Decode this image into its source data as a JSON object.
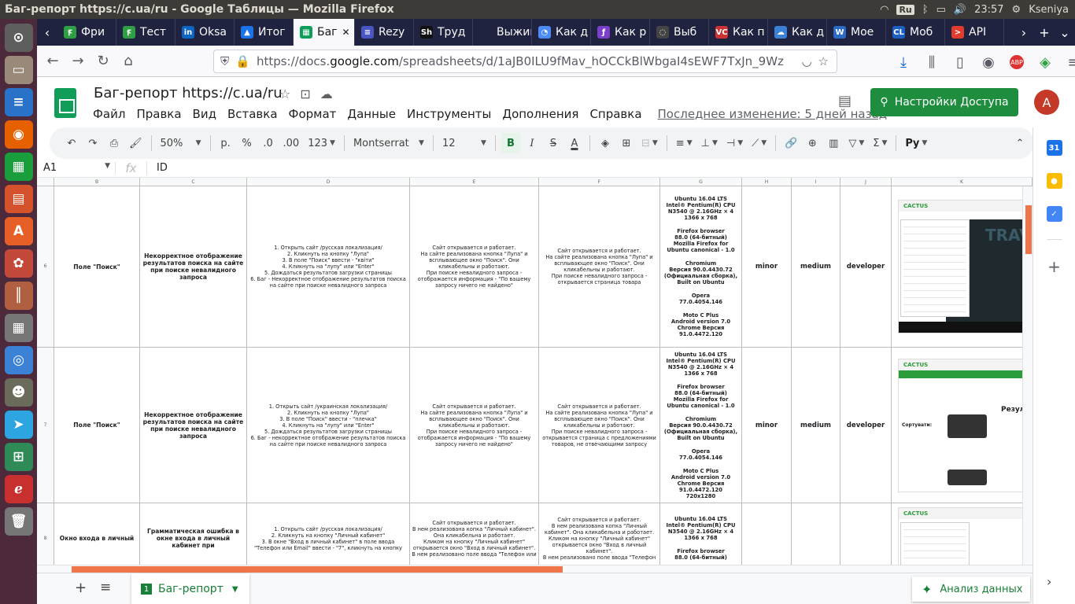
{
  "os": {
    "window_title": "Баг-репорт https://c.ua/ru - Google Таблицы — Mozilla Firefox",
    "keyboard_layout": "Ru",
    "clock": "23:57",
    "user": "Kseniya"
  },
  "launcher": [
    {
      "name": "ubuntu-settings",
      "glyph": "⊙",
      "color": "#5e5e5e"
    },
    {
      "name": "files",
      "glyph": "▭",
      "color": "#9a8a7a"
    },
    {
      "name": "writer",
      "glyph": "≡",
      "color": "#2a72c8"
    },
    {
      "name": "firefox",
      "glyph": "◉",
      "color": "#e66000"
    },
    {
      "name": "calc",
      "glyph": "▦",
      "color": "#1a9e3b"
    },
    {
      "name": "impress",
      "glyph": "▤",
      "color": "#d4532c"
    },
    {
      "name": "software",
      "glyph": "A",
      "color": "#e65f27"
    },
    {
      "name": "system-settings",
      "glyph": "✿",
      "color": "#c34a3a"
    },
    {
      "name": "sound-mixer",
      "glyph": "║",
      "color": "#b06040"
    },
    {
      "name": "calculator",
      "glyph": "▦",
      "color": "#777"
    },
    {
      "name": "chromium",
      "glyph": "◎",
      "color": "#3b82d6"
    },
    {
      "name": "gimp",
      "glyph": "☻",
      "color": "#6b6b5b"
    },
    {
      "name": "telegram",
      "glyph": "➤",
      "color": "#2ca5e0"
    },
    {
      "name": "windows",
      "glyph": "⊞",
      "color": "#2e8b57"
    },
    {
      "name": "lightworks",
      "glyph": "ℯ",
      "color": "#c83030"
    },
    {
      "name": "trash",
      "glyph": "🗑",
      "color": "#777"
    }
  ],
  "tabs": [
    {
      "label": "Фри",
      "fav": "Ꞙ",
      "color": "#2ea043"
    },
    {
      "label": "Тест",
      "fav": "Ꞙ",
      "color": "#2ea043"
    },
    {
      "label": "Oksa",
      "fav": "in",
      "color": "#0a66c2"
    },
    {
      "label": "Итог",
      "fav": "▲",
      "color": "#1a73e8"
    },
    {
      "label": "Баг",
      "fav": "▦",
      "color": "#0f9d58",
      "active": true
    },
    {
      "label": "Rezy",
      "fav": "≡",
      "color": "#4a55c4"
    },
    {
      "label": "Труд",
      "fav": "Sh",
      "color": "#111"
    },
    {
      "label": "Выжим",
      "fav": "",
      "color": "#202340"
    },
    {
      "label": "Как д",
      "fav": "◔",
      "color": "#4c8bf5"
    },
    {
      "label": "Как р",
      "fav": "ƒ",
      "color": "#7b3fc9"
    },
    {
      "label": "Выб",
      "fav": "◌",
      "color": "#444"
    },
    {
      "label": "Как п",
      "fav": "VC",
      "color": "#c33"
    },
    {
      "label": "Как д",
      "fav": "☁",
      "color": "#3b82d6"
    },
    {
      "label": "Мое",
      "fav": "W",
      "color": "#2b6bc8"
    },
    {
      "label": "Моб",
      "fav": "CL",
      "color": "#1b5fbf"
    },
    {
      "label": "API",
      "fav": ">",
      "color": "#e03b2c"
    }
  ],
  "navbar": {
    "url_prefix": "https://docs.",
    "url_domain": "google.com",
    "url_rest": "/spreadsheets/d/1aJB0ILU9fMav_hOCCkBlWbgaI4sEWF7TxJn_9Wz",
    "abp_label": "ABP"
  },
  "doc": {
    "title": "Баг-репорт https://c.ua/ru",
    "menus": [
      "Файл",
      "Правка",
      "Вид",
      "Вставка",
      "Формат",
      "Данные",
      "Инструменты",
      "Дополнения",
      "Справка"
    ],
    "last_edit": "Последнее изменение: 5 дней назад",
    "share_label": "Настройки Доступа",
    "avatar_letter": "A"
  },
  "toolbar": {
    "zoom": "50%",
    "currency": "р.",
    "percent": "%",
    "dec_less": ".0",
    "dec_more": ".00",
    "format_more": "123",
    "font": "Montserrat",
    "font_size": "12",
    "bold": "B",
    "italic": "I",
    "strike": "S",
    "text_color": "A",
    "input_tools": "Ру"
  },
  "formula": {
    "cell_ref": "A1",
    "fx": "fx",
    "value": "ID"
  },
  "columns": [
    "B",
    "C",
    "D",
    "E",
    "F",
    "G",
    "H",
    "I",
    "J",
    "K"
  ],
  "rows": [
    {
      "num": "6",
      "component": "Поле \"Поиск\"",
      "summary": "Некорректное отображение результатов поиска на сайте при поиске невалидного запроса",
      "steps": "1. Открыть сайт /русская локализация/\n2. Кликнуть на кнопку \"Лупа\"\n3. В поле \"Поиск\" ввести - \"квіти\"\n4. Кликнуть на \"лупу\" или \"Enter\"\n5. Дождаться результатов загрузки страницы\n6. Баг - Некорректное отображение результатов поиска на сайте при поиске невалидного запроса",
      "expected": "Сайт открывается и работает.\nНа сайте реализована кнопка \"Лупа\" и всплывающее окно \"Поиск\". Они кликабельны и работают.\nПри поиске невалидного запроса - отображается информация - \"По вашему запросу ничего не найдено\"",
      "actual": "Сайт открывается и работает.\nНа сайте реализована кнопка \"Лупа\" и всплывающее окно \"Поиск\". Они кликабельны и работают.\nПри поиске невалидного запроса - открывается страница товара",
      "env": [
        "Ubuntu 16.04 LTS\nIntel® Pentium(R) CPU N3540 @ 2.16GHz × 4\n1366 x 768",
        "Firefox browser\n88.0 (64-битный)\nMozilla Firefox for Ubuntu canonical - 1.0",
        "Chromium\nВерсия 90.0.4430.72 (Официальная сборка), Built on Ubuntu",
        "Opera\n77.0.4054.146",
        "Moto C Plus\nAndroid version 7.0\nChrome Версия 91.0.4472.120"
      ],
      "severity": "minor",
      "priority": "medium",
      "assignee": "developer",
      "height": 205
    },
    {
      "num": "7",
      "component": "Поле \"Поиск\"",
      "summary": "Некорректное отображение результатов поиска на сайте при поиске невалидного запроса",
      "steps": "1. Открыть сайт /украинская локализация/\n2. Кликнуть на кнопку \"Лупа\"\n3. В поле \"Поиск\" ввести - \"плечка\"\n4. Кликнуть на \"лупу\" или \"Enter\"\n5. Дождаться результатов загрузки страницы\n6. Баг - некорректное отображение результатов поиска на сайте при поиске невалидного запроса",
      "expected": "Сайт открывается и работает.\nНа сайте реализована кнопка \"Лупа\" и всплывающее окно \"Поиск\". Они кликабельны и работают.\nПри поиске невалидного запроса - отображается информация - \"По вашему запросу ничего не найдено\"",
      "actual": "Сайт открывается и работает.\nНа сайте реализована кнопка \"Лупа\" и всплывающее окно \"Поиск\". Они кликабельны и работают.\nПри поиске невалидного запроса - открывается страница с предложениями товаров, не отвечающими запросу",
      "env": [
        "Ubuntu 16.04 LTS\nIntel® Pentium(R) CPU N3540 @ 2.16GHz × 4\n1366 x 768",
        "Firefox browser\n88.0 (64-битный)\nMozilla Firefox for Ubuntu canonical - 1.0",
        "Chromium\nВерсия 90.0.4430.72 (Официальная сборка), Built on Ubuntu",
        "Opera\n77.0.4054.146",
        "Moto C Plus\nAndroid version 7.0\nChrome Версия 91.0.4472.120\n720x1280"
      ],
      "severity": "minor",
      "priority": "medium",
      "assignee": "developer",
      "height": 198
    },
    {
      "num": "8",
      "component": "Окно входа в личный",
      "summary": "Грамматическая ошибка в окне входа в личный кабинет при",
      "steps": "1. Открыть сайт /русская локализация/\n2. Кликнуть на кнопку \"Личный кабинет\"\n3. В окне \"Вход в личный кабинет\" в поле ввода \"Телефон или Email\" ввести - \"7\", кликнуть на кнопку",
      "expected": "Сайт открывается и работает.\nВ нем реализована копка \"Личный кабинет\". Она кликабельна и работает.\nКликом на кнопку \"Личный кабинет\" открывается окно \"Вход в личный кабинет\".\nВ нем реализовано поле ввода \"Телефон или",
      "actual": "Сайт открывается и работает.\nВ нем реализована копка \"Личный кабинет\". Она кликабельна и работает.\nКликом на кнопку \"Личный кабинет\" открывается окно \"Вход в личный кабинет\".\nВ нем реализовано поле ввода \"Телефон",
      "env": [
        "Ubuntu 16.04 LTS\nIntel® Pentium(R) CPU N3540 @ 2.16GHz × 4\n1366 x 768",
        "Firefox browser\n88.0 (64-битный)"
      ],
      "severity": "",
      "priority": "",
      "assignee": "",
      "height": 90
    }
  ],
  "screenshot_text": {
    "brand": "CACTUS",
    "travel": "TRAV",
    "results": "Резуль",
    "sort": "Сортувати:"
  },
  "bottom": {
    "sheet_name": "Баг-репорт",
    "sheet_num": "1",
    "explore": "Анализ данных"
  },
  "side_apps": [
    {
      "name": "calendar",
      "glyph": "31",
      "color": "#1a73e8"
    },
    {
      "name": "keep",
      "glyph": "●",
      "color": "#fbbc04"
    },
    {
      "name": "tasks",
      "glyph": "✓",
      "color": "#4285f4"
    }
  ]
}
